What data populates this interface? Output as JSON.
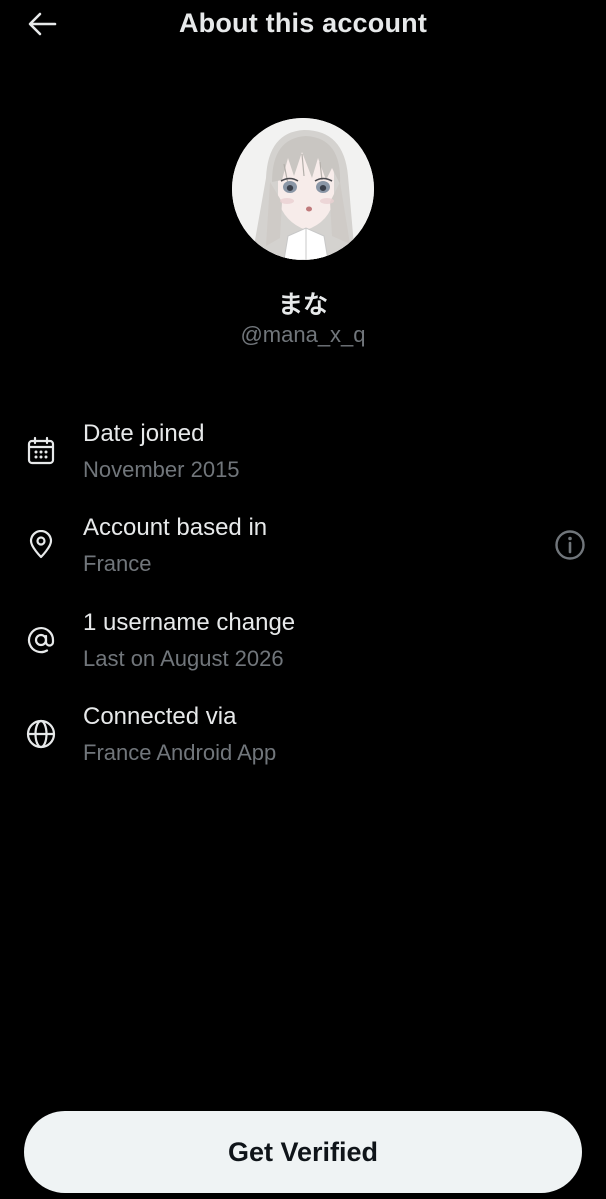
{
  "header": {
    "title": "About this account",
    "back_icon": "arrow-left-icon"
  },
  "profile": {
    "display_name": "まな",
    "handle": "@mana_x_q",
    "avatar": "avatar-illustration"
  },
  "details": [
    {
      "icon": "calendar-icon",
      "label": "Date joined",
      "value": "November 2015"
    },
    {
      "icon": "location-pin-icon",
      "label": "Account based in",
      "value": "France",
      "trailing_icon": "info-circle-icon"
    },
    {
      "icon": "at-sign-icon",
      "label": "1 username change",
      "value": "Last on August 2026"
    },
    {
      "icon": "globe-icon",
      "label": "Connected via",
      "value": "France Android App"
    }
  ],
  "footer": {
    "verify_label": "Get Verified"
  },
  "colors": {
    "background": "#000000",
    "primary_text": "#e7e9ea",
    "secondary_text": "#71767b",
    "button_bg": "#eff3f4",
    "button_text": "#0f1419"
  }
}
